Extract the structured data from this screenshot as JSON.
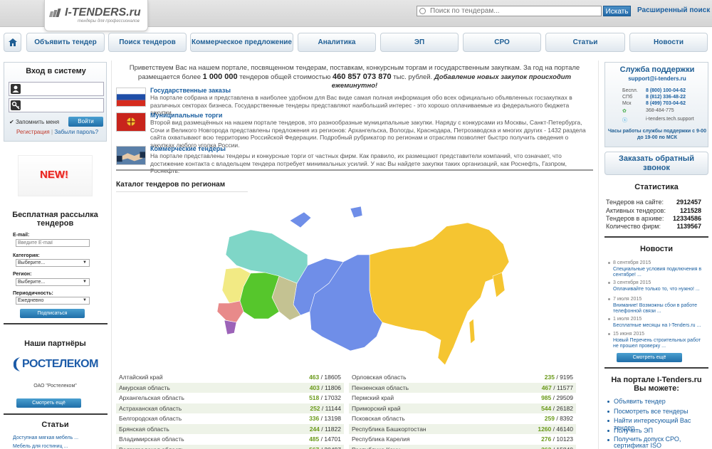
{
  "header": {
    "logo_name": "I-TENDERS.ru",
    "logo_tagline": "тендеры для профессионалов",
    "search_placeholder": "Поиск по тендерам...",
    "search_button": "Искать",
    "advanced_search": "Расширенный поиск"
  },
  "nav": [
    "Объявить тендер",
    "Поиск тендеров",
    "Коммерческое предложение",
    "Аналитика",
    "ЭП",
    "СРО",
    "Статьи",
    "Новости"
  ],
  "login": {
    "title": "Вход в систему",
    "remember": "Запомнить меня",
    "button": "Войти",
    "register": "Регистрация",
    "separator": "|",
    "forgot": "Забыли пароль?"
  },
  "new_badge": "NEW!",
  "mailing": {
    "title": "Бесплатная рассылка тендеров",
    "email_label": "E-mail:",
    "email_placeholder": "Введите E-mail",
    "category_label": "Категория:",
    "category_value": "Выберите...",
    "region_label": "Регион:",
    "region_value": "Выберите...",
    "period_label": "Периодичность:",
    "period_value": "Ежедневно",
    "subscribe": "Подписаться"
  },
  "partners": {
    "title": "Наши партнёры",
    "logo_text": "РОСТЕЛЕКОМ",
    "caption": "ОАО \"Ростелеком\"",
    "more": "Смотреть ещё"
  },
  "articles": {
    "title": "Статьи",
    "items": [
      "Доступная мягкая мебель ...",
      "Мебель для гостиниц ..."
    ]
  },
  "intro": {
    "text_pre": "Приветствуем Вас на нашем портале, посвященном тендерам, поставкам, конкурсным торгам и государственным закупкам. За год на портале размещается более",
    "count": "1 000 000",
    "text_mid": "тендеров общей стоимостью",
    "sum": "460 857 073 870",
    "text_post": "тыс. рублей.",
    "daily": "Добавление новых закупок происходит ежеминутно!"
  },
  "sections": [
    {
      "title": "Государственные заказы",
      "text": "На портале собрана и представлена в наиболее удобном для Вас виде самая полная информация обо всех официально объявленных госзакупках в различных секторах бизнеса. Государственные тендеры представляют наибольший интерес - это хорошо оплачиваемые из федерального бюджета закупки."
    },
    {
      "title": "Муниципальные торги",
      "text": "Второй вид размещённых на нашем портале тендеров, это разнообразные муниципальные закупки. Наряду с конкурсами из Москвы, Санкт-Петербурга, Сочи и Великого Новгорода представлены предложения из регионов: Архангельска, Вологды, Краснодара, Петрозаводска и многих других - 1432 раздела сайта охватывают всю территорию Российской Федерации. Подробный рубрикатор по регионам и отраслям позволяет быстро получить сведения о закупках любого уголка России."
    },
    {
      "title": "Коммерческие тендеры",
      "text": "На портале представлены тендеры и конкурсные торги от частных фирм. Как правило, их размещают представители компаний, что означает, что достижение контакта с владельцем тендера потребует минимальных усилий. У нас Вы найдете закупки таких организаций, как Роснефть, Газпром, Роснефть."
    }
  ],
  "catalog_title": "Каталог тендеров по регионам",
  "regions_left": [
    {
      "name": "Алтайский край",
      "a": "463",
      "b": "18605"
    },
    {
      "name": "Амурская область",
      "a": "403",
      "b": "11806"
    },
    {
      "name": "Архангельская область",
      "a": "518",
      "b": "17032"
    },
    {
      "name": "Астраханская область",
      "a": "252",
      "b": "11144"
    },
    {
      "name": "Белгородская область",
      "a": "336",
      "b": "13198"
    },
    {
      "name": "Брянская область",
      "a": "244",
      "b": "11822"
    },
    {
      "name": "Владимирская область",
      "a": "485",
      "b": "14701"
    },
    {
      "name": "Волгоградская область",
      "a": "567",
      "b": "20497"
    }
  ],
  "regions_right": [
    {
      "name": "Орловская область",
      "a": "235",
      "b": "9195"
    },
    {
      "name": "Пензенская область",
      "a": "467",
      "b": "11577"
    },
    {
      "name": "Пермский край",
      "a": "985",
      "b": "29509"
    },
    {
      "name": "Приморский край",
      "a": "544",
      "b": "26182"
    },
    {
      "name": "Псковская область",
      "a": "259",
      "b": "8392"
    },
    {
      "name": "Республика Башкортостан",
      "a": "1260",
      "b": "46140"
    },
    {
      "name": "Республика Карелия",
      "a": "276",
      "b": "10123"
    },
    {
      "name": "Республика Коми",
      "a": "363",
      "b": "15840"
    }
  ],
  "support": {
    "title": "Служба поддержки",
    "email": "support@i-tenders.ru",
    "rows": [
      {
        "label": "Беспл.",
        "value": "8 (800) 100-04-62"
      },
      {
        "label": "СПб",
        "value": "8 (812) 336-48-22"
      },
      {
        "label": "Мск",
        "value": "8 (499) 703-04-62"
      },
      {
        "label": "",
        "value": "368-484-775"
      },
      {
        "label": "",
        "value": "i-tenders.tech.support"
      }
    ],
    "hours": "Часы работы службы поддержки с 9-00 до 19-00 по МСК"
  },
  "callback": "Заказать обратный звонок",
  "stats": {
    "title": "Статистика",
    "rows": [
      {
        "label": "Тендеров на сайте:",
        "value": "2912457"
      },
      {
        "label": "Активных тендеров:",
        "value": "121528"
      },
      {
        "label": "Тендеров в архиве:",
        "value": "12334586"
      },
      {
        "label": "Количество фирм:",
        "value": "1139567"
      }
    ]
  },
  "news": {
    "title": "Новости",
    "items": [
      {
        "date": "8 сентября 2015",
        "text": "Специальные условия подключения в сентябре! ..."
      },
      {
        "date": "3 сентября 2015",
        "text": "Оплачивайте только то, что нужно! ..."
      },
      {
        "date": "7 июля 2015",
        "text": "Внимание! Возможны сбои в работе телефонной связи ..."
      },
      {
        "date": "1 июля 2015",
        "text": "Бесплатные месяцы на I-Tenders.ru ..."
      },
      {
        "date": "15 июня 2015",
        "text": "Новый Перечень строительных работ не прошел проверку ..."
      }
    ],
    "more": "Смотреть ещё"
  },
  "can_do": {
    "title": "На портале I-Tenders.ru Вы можете:",
    "items": [
      "Объявить тендер",
      "Посмотреть все тендеры",
      "Найти интересующий Вас тендер",
      "Получить ЭП",
      "Получить допуск СРО, сертификат ISO"
    ]
  },
  "colors": {
    "accent": "#1f5e94",
    "link": "#1a5fa0",
    "button": "#236aa8",
    "count_green": "#6a9a1a"
  }
}
